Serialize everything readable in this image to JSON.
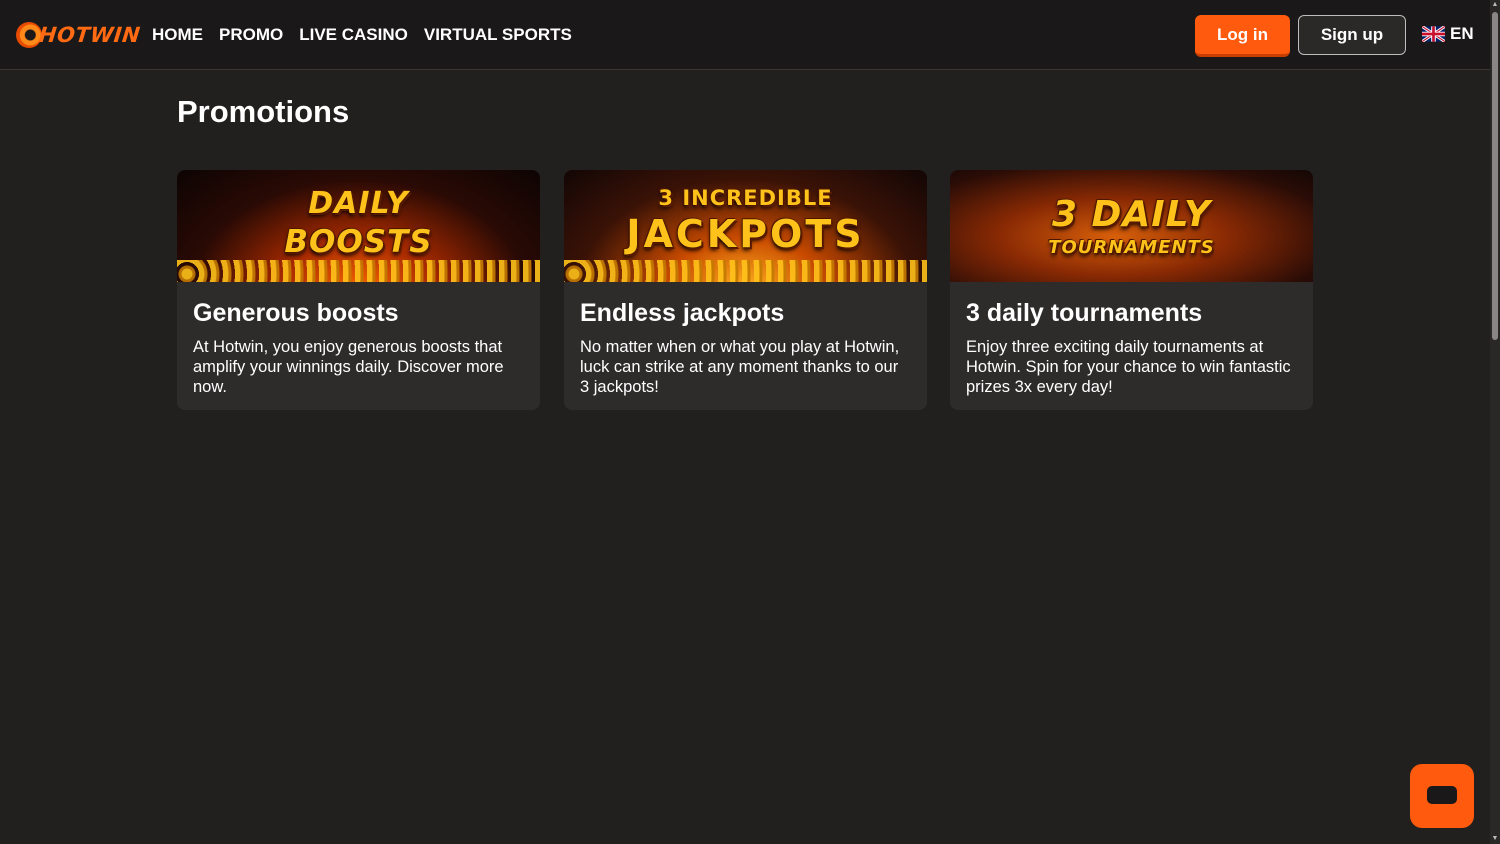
{
  "header": {
    "logo_text": "HOTWIN",
    "nav": [
      "HOME",
      "PROMO",
      "LIVE CASINO",
      "VIRTUAL SPORTS"
    ],
    "login_label": "Log in",
    "signup_label": "Sign up",
    "language": "EN"
  },
  "page": {
    "title": "Promotions"
  },
  "cards": [
    {
      "banner_lines": [
        "DAILY",
        "BOOSTS"
      ],
      "title": "Generous boosts",
      "description": "At Hotwin, you enjoy generous boosts that amplify your winnings daily. Discover more now."
    },
    {
      "banner_lines": [
        "3 INCREDIBLE",
        "JACKPOTS"
      ],
      "title": "Endless jackpots",
      "description": "No matter when or what you play at Hotwin, luck can strike at any moment thanks to our 3 jackpots!"
    },
    {
      "banner_lines": [
        "3 DAILY",
        "TOURNAMENTS"
      ],
      "title": "3 daily tournaments",
      "description": "Enjoy three exciting daily tournaments at Hotwin. Spin for your chance to win fantastic prizes 3x every day!"
    }
  ],
  "colors": {
    "accent": "#ff5a0e",
    "background": "#221f1f",
    "card": "#2e2b2b",
    "header": "#1a1818"
  },
  "icons": [
    "logo-sun-icon",
    "uk-flag-icon",
    "chat-icon"
  ]
}
